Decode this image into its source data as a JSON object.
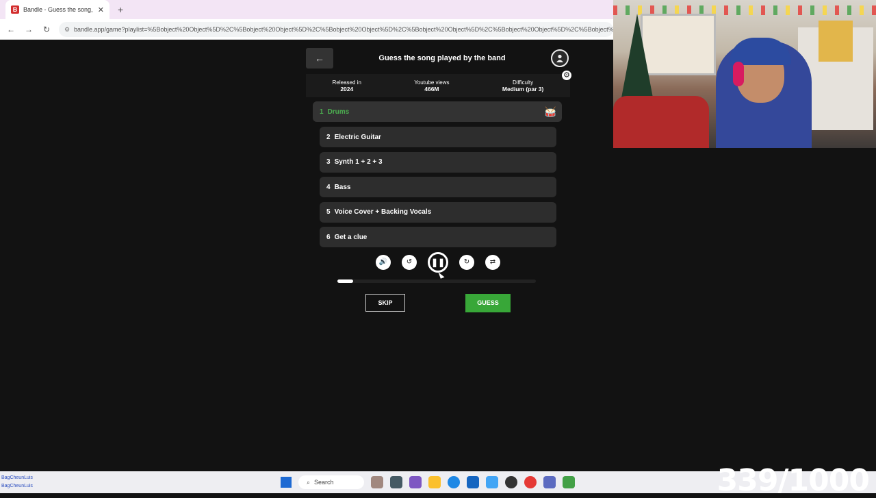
{
  "browser": {
    "tab_title": "Bandle - Guess the song, or",
    "url": "bandle.app/game?playlist=%5Bobject%20Object%5D%2C%5Bobject%20Object%5D%2C%5Bobject%20Object%5D%2C%5Bobject%20Object%5D%2C%5Bobject%20Object%5D%2C%5Bobject%20Object%5D%2C%5Bobject%20Object%5D"
  },
  "game": {
    "title": "Guess the song played by the band",
    "released_label": "Released in",
    "released_value": "2024",
    "views_label": "Youtube views",
    "views_value": "466M",
    "difficulty_label": "Difficulty",
    "difficulty_value": "Medium (par 3)",
    "tracks": [
      {
        "num": "1",
        "label": "Drums"
      },
      {
        "num": "2",
        "label": "Electric Guitar"
      },
      {
        "num": "3",
        "label": "Synth 1 + 2 + 3"
      },
      {
        "num": "4",
        "label": "Bass"
      },
      {
        "num": "5",
        "label": "Voice Cover + Backing Vocals"
      },
      {
        "num": "6",
        "label": "Get a clue"
      }
    ],
    "progress_fraction": 0.08,
    "skip_label": "SKIP",
    "guess_label": "GUESS"
  },
  "taskbar": {
    "search_label": "Search",
    "user_line1": "BagCheunLuis",
    "user_line2": "BagCheunLuis"
  },
  "overlay": {
    "counter": "339/1000"
  },
  "colors": {
    "background": "#121212",
    "accent_green": "#38a738",
    "active_track": "#4caf50"
  }
}
